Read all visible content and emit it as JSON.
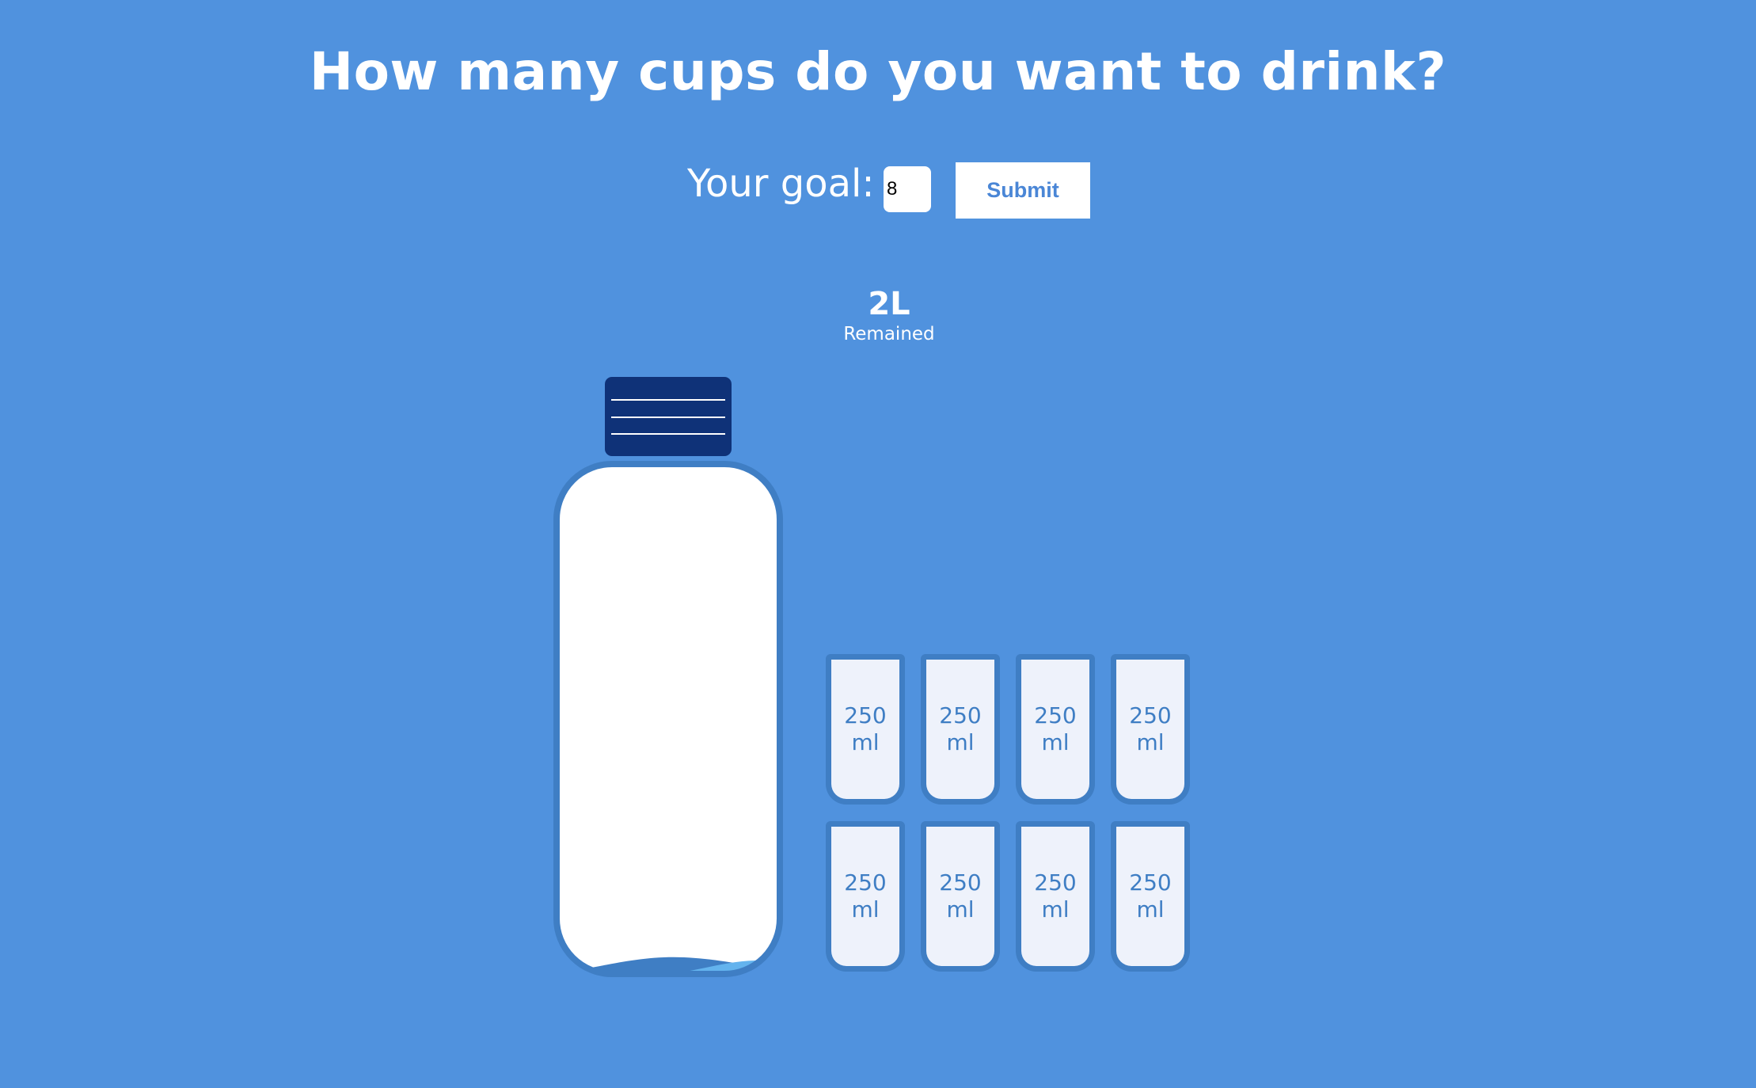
{
  "header": {
    "title": "How many cups do you want to drink?"
  },
  "goal": {
    "label": "Your goal:",
    "value": "8",
    "submit_label": "Submit"
  },
  "remained": {
    "amount": "2L",
    "label": "Remained"
  },
  "bottle": {
    "fill_fraction": 0.02
  },
  "cups": [
    {
      "label": "250 ml"
    },
    {
      "label": "250 ml"
    },
    {
      "label": "250 ml"
    },
    {
      "label": "250 ml"
    },
    {
      "label": "250 ml"
    },
    {
      "label": "250 ml"
    },
    {
      "label": "250 ml"
    },
    {
      "label": "250 ml"
    }
  ],
  "colors": {
    "background": "#5092de",
    "cap": "#0f3278",
    "bottle_outline": "#3f7ec4",
    "water_dark": "#3f7ec4",
    "water_light": "#63b3ee",
    "cup_fill": "#eef2fb"
  }
}
